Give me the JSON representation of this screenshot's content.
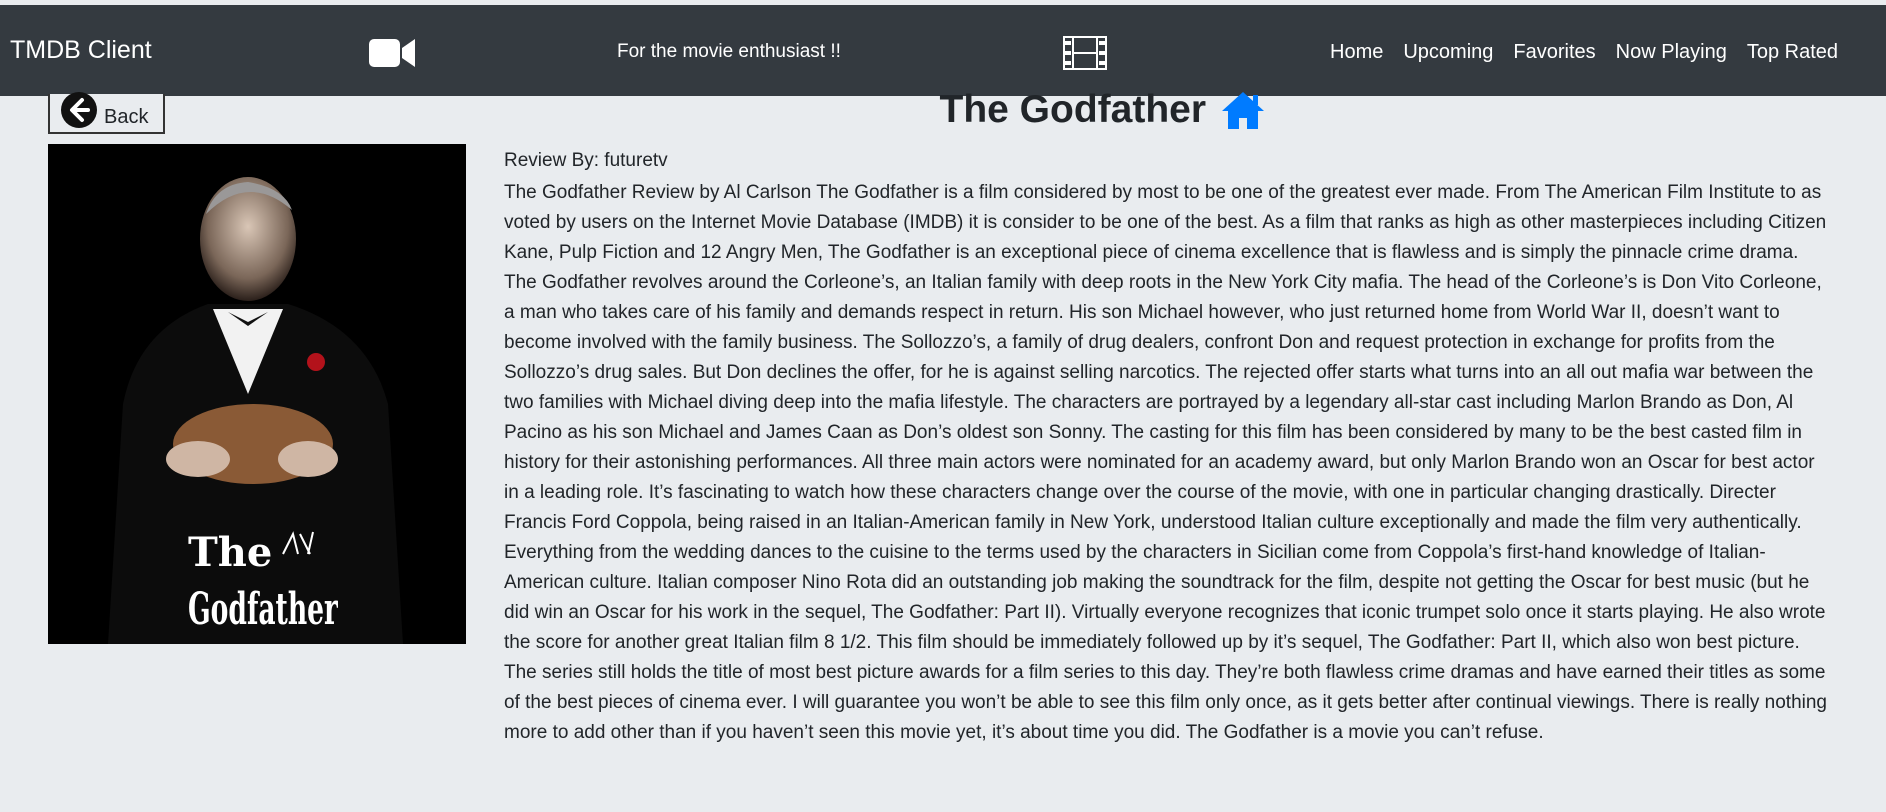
{
  "navbar": {
    "brand": "TMDB Client",
    "tagline": "For the movie enthusiast !!",
    "links": [
      "Home",
      "Upcoming",
      "Favorites",
      "Now Playing",
      "Top Rated"
    ],
    "background": "#343a40"
  },
  "back_button": {
    "label": "Back",
    "icon": "arrow-left-circle-icon"
  },
  "movie": {
    "title": "The Godfather",
    "title_icon": "home-icon",
    "title_icon_color": "#007bff",
    "poster_caption": "The Godfather"
  },
  "review": {
    "author_line": "Review By: futuretv",
    "text": "The Godfather Review by Al Carlson The Godfather is a film considered by most to be one of the greatest ever made. From The American Film Institute to as voted by users on the Internet Movie Database (IMDB) it is consider to be one of the best. As a film that ranks as high as other masterpieces including Citizen Kane, Pulp Fiction and 12 Angry Men, The Godfather is an exceptional piece of cinema excellence that is flawless and is simply the pinnacle crime drama. The Godfather revolves around the Corleone’s, an Italian family with deep roots in the New York City mafia. The head of the Corleone’s is Don Vito Corleone, a man who takes care of his family and demands respect in return. His son Michael however, who just returned home from World War II, doesn’t want to become involved with the family business. The Sollozzo’s, a family of drug dealers, confront Don and request protection in exchange for profits from the Sollozzo’s drug sales. But Don declines the offer, for he is against selling narcotics. The rejected offer starts what turns into an all out mafia war between the two families with Michael diving deep into the mafia lifestyle. The characters are portrayed by a legendary all-star cast including Marlon Brando as Don, Al Pacino as his son Michael and James Caan as Don’s oldest son Sonny. The casting for this film has been considered by many to be the best casted film in history for their astonishing performances. All three main actors were nominated for an academy award, but only Marlon Brando won an Oscar for best actor in a leading role. It’s fascinating to watch how these characters change over the course of the movie, with one in particular changing drastically. Directer Francis Ford Coppola, being raised in an Italian-American family in New York, understood Italian culture exceptionally and made the film very authentically. Everything from the wedding dances to the cuisine to the terms used by the characters in Sicilian come from Coppola’s first-hand knowledge of Italian-American culture. Italian composer Nino Rota did an outstanding job making the soundtrack for the film, despite not getting the Oscar for best music (but he did win an Oscar for his work in the sequel, The Godfather: Part II). Virtually everyone recognizes that iconic trumpet solo once it starts playing. He also wrote the score for another great Italian film 8 1/2. This film should be immediately followed up by it’s sequel, The Godfather: Part II, which also won best picture. The series still holds the title of most best picture awards for a film series to this day. They’re both flawless crime dramas and have earned their titles as some of the best pieces of cinema ever. I will guarantee you won’t be able to see this film only once, as it gets better after continual viewings. There is really nothing more to add other than if you haven’t seen this movie yet, it’s about time you did. The Godfather is a movie you can’t refuse."
  },
  "icons": {
    "nav_left": "video-camera-icon",
    "nav_right": "film-strip-icon"
  }
}
